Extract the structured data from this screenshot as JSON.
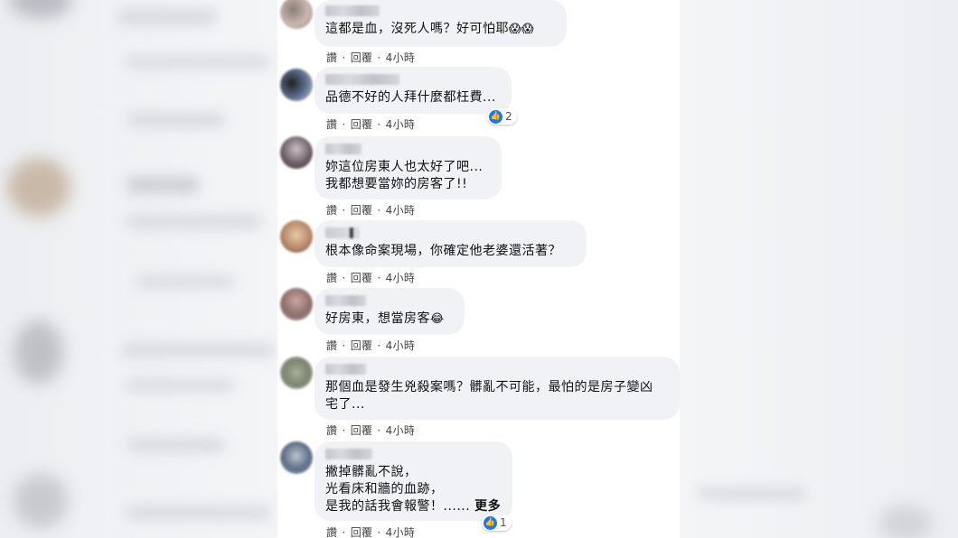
{
  "comments": [
    {
      "text": "這都是血，沒死人嗎？好可怕耶",
      "emojis": "😱😱",
      "actions": [
        "讚",
        "回覆"
      ],
      "time": "4小時"
    },
    {
      "text": "品德不好的人拜什麼都枉費...",
      "reaction_count": "2",
      "actions": [
        "讚",
        "回覆"
      ],
      "time": "4小時"
    },
    {
      "text": "妳這位房東人也太好了吧...\n我都想要當妳的房客了!!",
      "actions": [
        "讚",
        "回覆"
      ],
      "time": "4小時"
    },
    {
      "text": "根本像命案現場，你確定他老婆還活著？",
      "actions": [
        "讚",
        "回覆"
      ],
      "time": "4小時"
    },
    {
      "text": "好房東，想當房客",
      "emojis": "😂",
      "actions": [
        "讚",
        "回覆"
      ],
      "time": "4小時"
    },
    {
      "text": "那個血是發生兇殺案嗎？髒亂不可能，最怕的是房子變凶\n宅了...",
      "actions": [
        "讚",
        "回覆"
      ],
      "time": "4小時"
    },
    {
      "text": "撇掉髒亂不說，\n光看床和牆的血跡，\n是我的話我會報警！......",
      "more": "更多",
      "reaction_count": "1",
      "actions": [
        "讚",
        "回覆"
      ],
      "time": "4小時"
    }
  ],
  "separator": "·",
  "icons": {
    "reaction": "like-icon"
  },
  "colors": {
    "bubble": "#f0f2f5",
    "like": "#1877f2"
  }
}
